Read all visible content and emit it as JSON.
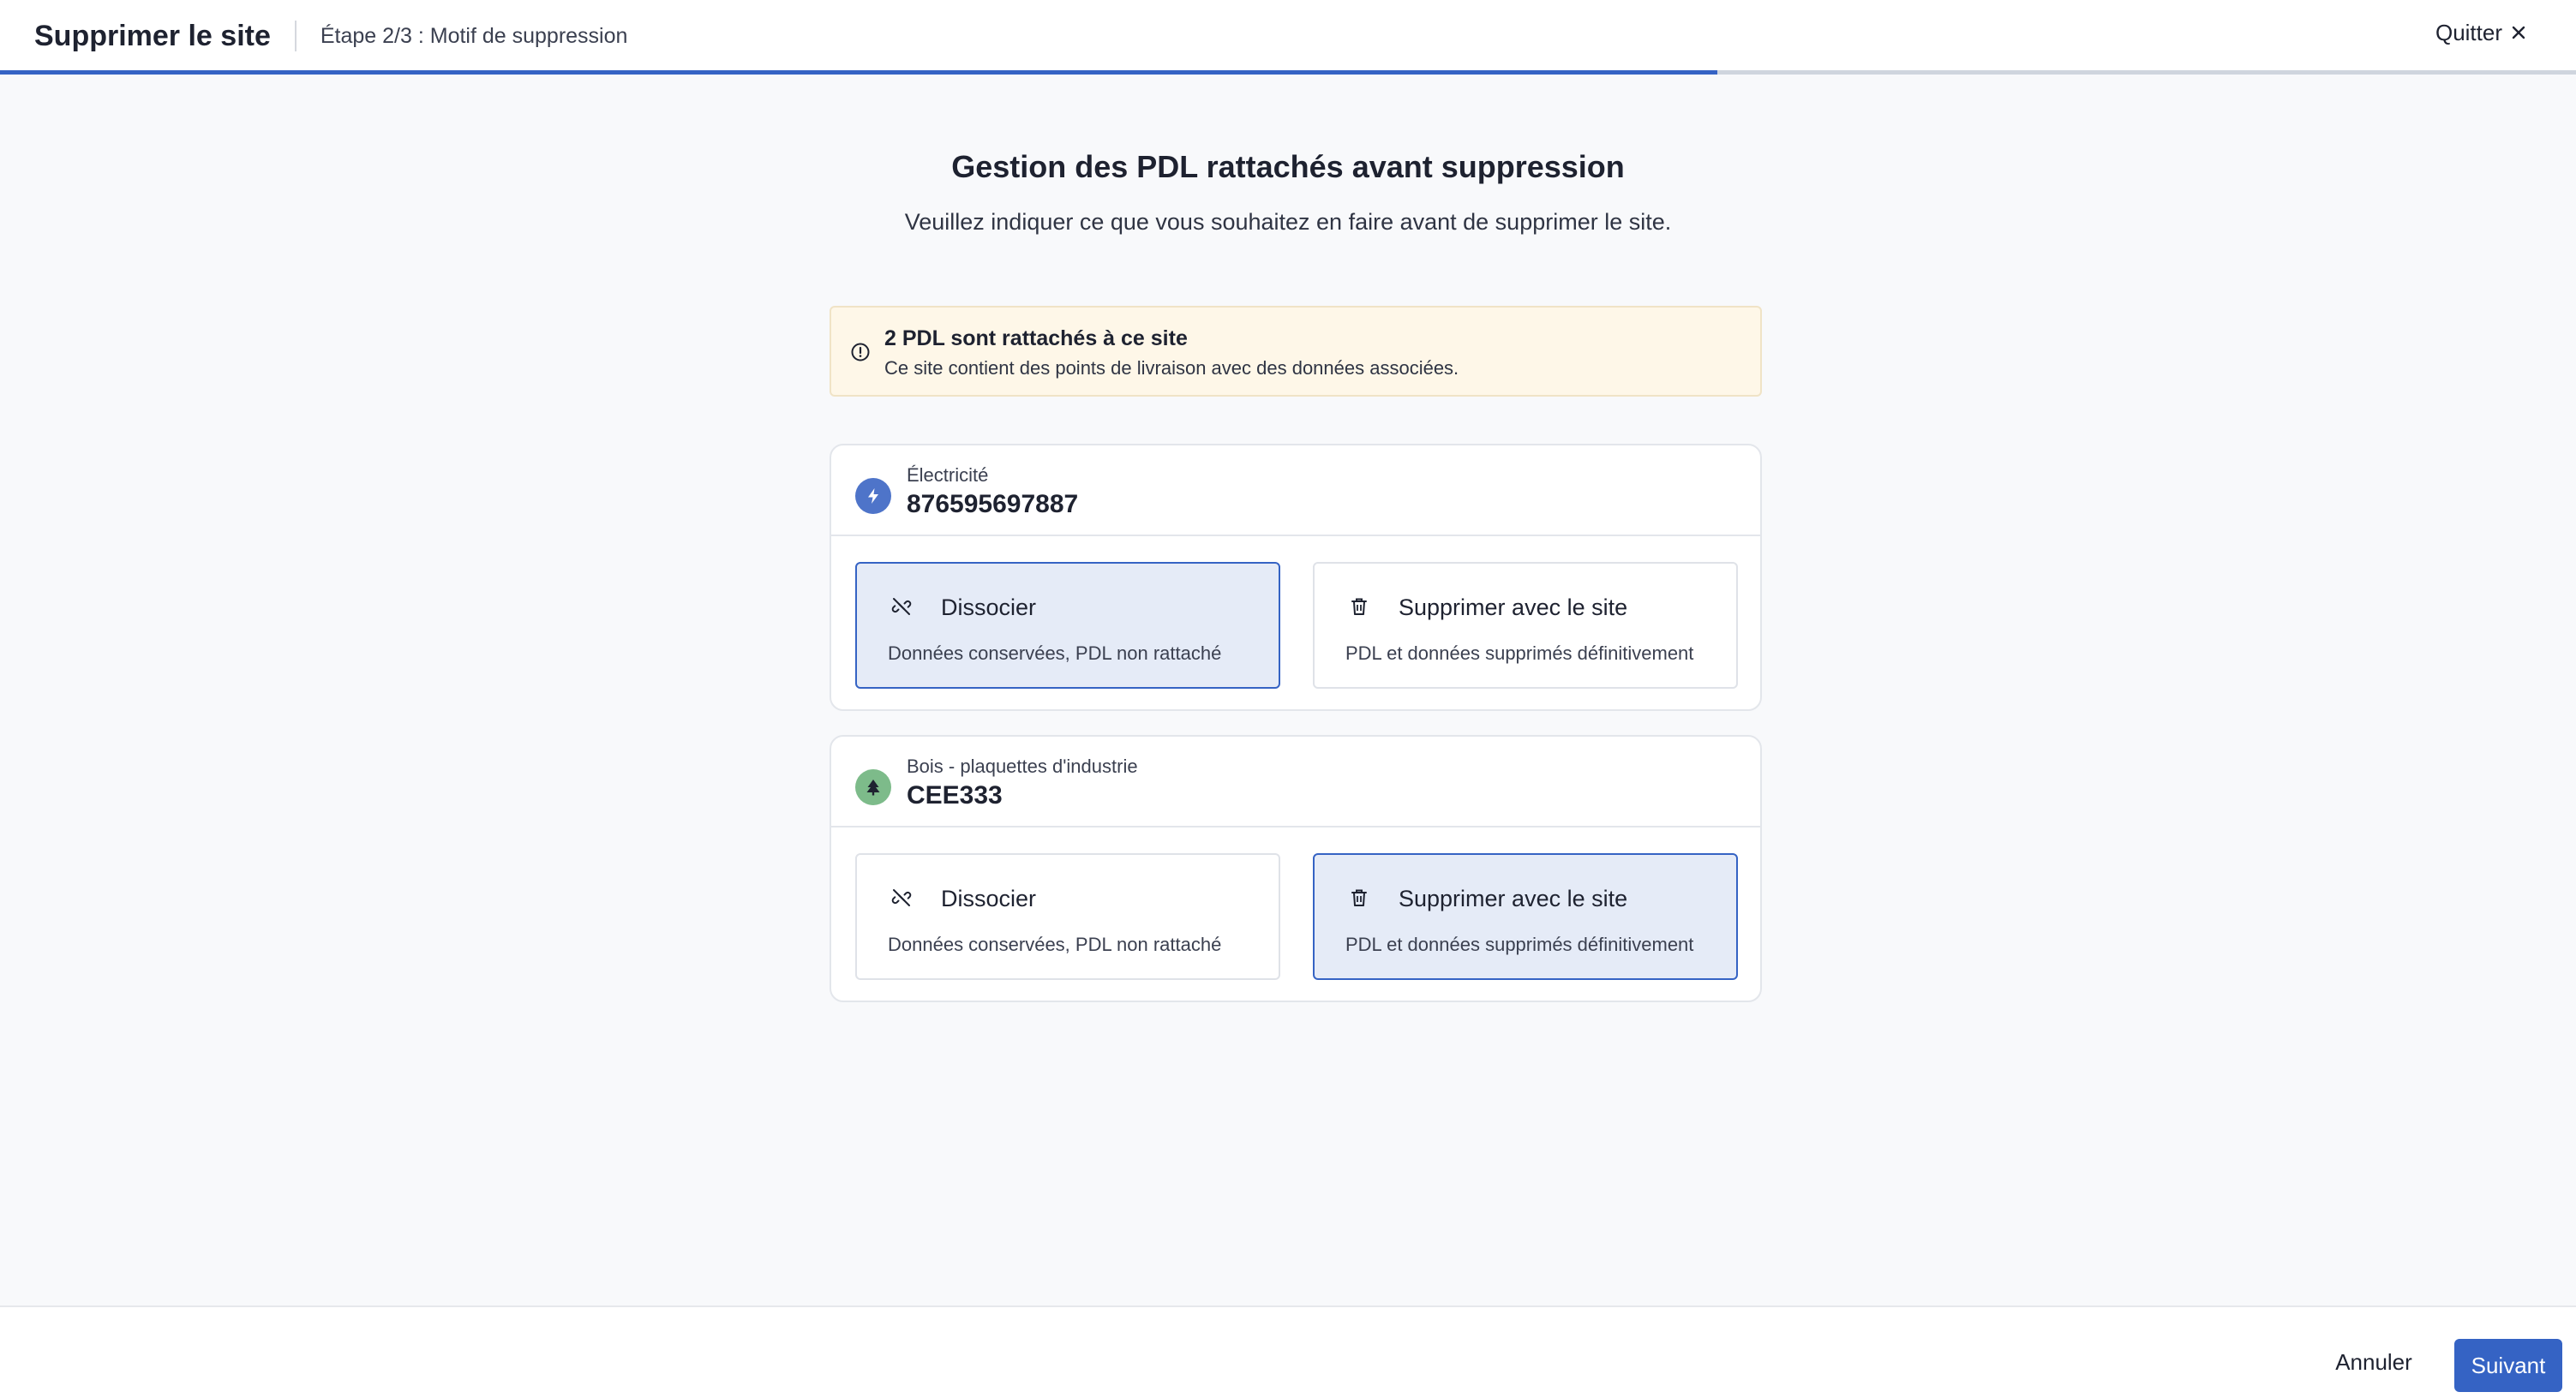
{
  "header": {
    "title": "Supprimer le site",
    "step": "Étape 2/3 : Motif de suppression",
    "quit_label": "Quitter"
  },
  "progress": {
    "fraction": 0.6667
  },
  "main": {
    "title": "Gestion des PDL rattachés avant suppression",
    "subtitle": "Veuillez indiquer ce que vous souhaitez en faire avant de supprimer le site."
  },
  "alert": {
    "title": "2 PDL sont rattachés à ce site",
    "text": "Ce site contient des points de livraison avec des données associées."
  },
  "pdls": [
    {
      "energy": "Électricité",
      "id": "876595697887",
      "icon": "lightning-icon",
      "icon_color": "#4e74c9",
      "selected": "dissocier"
    },
    {
      "energy": "Bois - plaquettes d'industrie",
      "id": "CEE333",
      "icon": "tree-icon",
      "icon_color": "#7dbb8a",
      "selected": "supprimer"
    }
  ],
  "options": {
    "dissocier": {
      "title": "Dissocier",
      "desc": "Données conservées, PDL non rattaché",
      "icon": "unlink-icon"
    },
    "supprimer": {
      "title": "Supprimer avec le site",
      "desc": "PDL et données supprimés définitivement",
      "icon": "trash-icon"
    }
  },
  "footer": {
    "cancel_label": "Annuler",
    "next_label": "Suivant"
  },
  "colors": {
    "primary": "#3563c4",
    "alert_bg": "#fef7e8",
    "selected_bg": "#e5ebf7"
  }
}
